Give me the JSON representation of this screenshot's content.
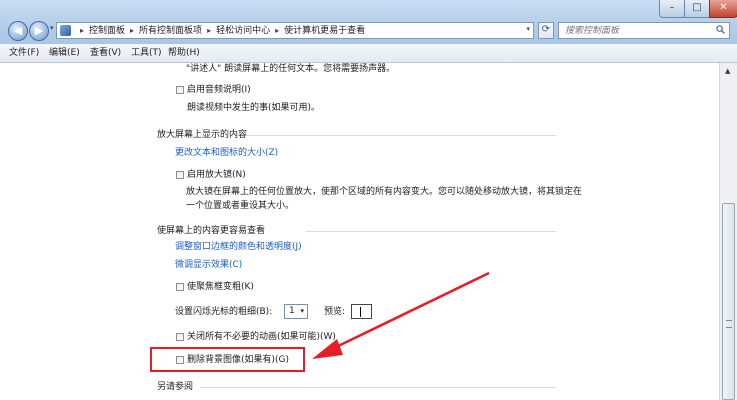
{
  "window": {
    "minimize_glyph": "–",
    "maximize_glyph": "□",
    "close_glyph": "✕"
  },
  "nav": {
    "back_glyph": "◀",
    "forward_glyph": "▶",
    "dropdown_glyph": "▾"
  },
  "address": {
    "crumbs": [
      "控制面板",
      "所有控制面板项",
      "轻松访问中心",
      "使计算机更易于查看"
    ],
    "separator": "▸",
    "dropdown_glyph": "▾",
    "refresh_glyph": "⟳"
  },
  "search": {
    "placeholder": "搜索控制面板"
  },
  "menu": {
    "file": "文件(F)",
    "edit": "编辑(E)",
    "view": "查看(V)",
    "tools": "工具(T)",
    "help": "帮助(H)"
  },
  "content": {
    "narrator_desc": "\"讲述人\" 朗读屏幕上的任何文本。您将需要扬声器。",
    "audio_desc_label": "启用音频说明(I)",
    "audio_desc_desc": "朗读视频中发生的事(如果可用)。",
    "magnify_section": "放大屏幕上显示的内容",
    "change_size_link": "更改文本和图标的大小(Z)",
    "magnifier_label": "启用放大镜(N)",
    "magnifier_desc_1": "放大镜在屏幕上的任何位置放大，使那个区域的所有内容变大。您可以随处移动放大镜，将其锁定在",
    "magnifier_desc_2": "一个位置或者重设其大小。",
    "easier_section": "使屏幕上的内容更容易查看",
    "window_color_link": "调整窗口边框的颜色和透明度(J)",
    "fine_tune_link": "微调显示效果(C)",
    "focus_label": "使聚焦框变粗(K)",
    "cursor_width_label": "设置闪烁光标的粗细(B):",
    "cursor_width_value": "1",
    "spin_arrow": "▾",
    "preview_label": "预览:",
    "animations_label": "关闭所有不必要的动画(如果可能)(W)",
    "background_label": "删除背景图像(如果有)(G)",
    "see_also": "另请参阅"
  },
  "scroll": {
    "up_glyph": "▲"
  },
  "colors": {
    "highlight": "#e41e25",
    "link": "#1c5ec1"
  }
}
